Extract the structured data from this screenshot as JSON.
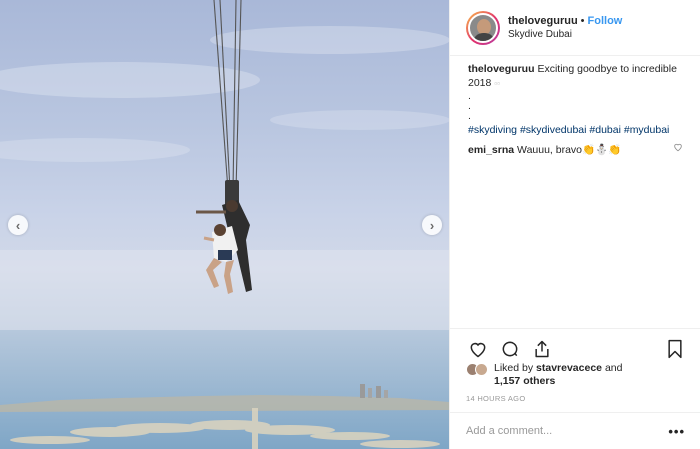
{
  "post": {
    "username": "theloveguruu",
    "separator": "•",
    "follow_label": "Follow",
    "location": "Skydive Dubai",
    "caption": {
      "username": "theloveguruu",
      "text": "Exciting goodbye to incredible 2018",
      "emoji": "▫▫",
      "dots": [
        ".",
        ".",
        "."
      ],
      "hashtags": "#skydiving #skydivedubai #dubai #mydubai"
    },
    "comments": [
      {
        "username": "emi_srna",
        "text": "Wauuu, bravo👏⛄👏"
      }
    ],
    "likes": {
      "prefix": "Liked by",
      "user": "stavrevacece",
      "and": "and",
      "others": "1,157 others"
    },
    "timestamp": "14 HOURS AGO",
    "comment_placeholder": "Add a comment...",
    "more_label": "•••"
  },
  "carousel": {
    "prev_icon": "chevron-left-icon",
    "next_icon": "chevron-right-icon",
    "prev_glyph": "‹",
    "next_glyph": "›"
  },
  "icons": {
    "like": "heart-icon",
    "comment": "comment-icon",
    "share": "share-icon",
    "save": "bookmark-icon"
  },
  "colors": {
    "link": "#3897f0",
    "hashtag": "#003569",
    "sky_top": "#a9b8d8",
    "sea": "#8fb3cf"
  }
}
